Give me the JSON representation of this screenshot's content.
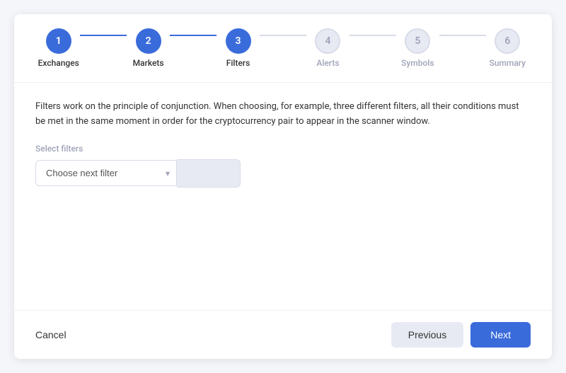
{
  "stepper": {
    "steps": [
      {
        "id": 1,
        "label": "Exchanges",
        "state": "completed"
      },
      {
        "id": 2,
        "label": "Markets",
        "state": "completed"
      },
      {
        "id": 3,
        "label": "Filters",
        "state": "completed"
      },
      {
        "id": 4,
        "label": "Alerts",
        "state": "inactive"
      },
      {
        "id": 5,
        "label": "Symbols",
        "state": "inactive"
      },
      {
        "id": 6,
        "label": "Summary",
        "state": "inactive"
      }
    ]
  },
  "content": {
    "description": "Filters work on the principle of conjunction. When choosing, for example, three different filters, all their conditions must be met in the same moment in order for the cryptocurrency pair to appear in the scanner window.",
    "filter_section_label": "Select filters",
    "filter_placeholder": "Choose next filter",
    "filter_add_label": ""
  },
  "footer": {
    "cancel_label": "Cancel",
    "previous_label": "Previous",
    "next_label": "Next"
  },
  "icons": {
    "chevron_down": "▾"
  }
}
